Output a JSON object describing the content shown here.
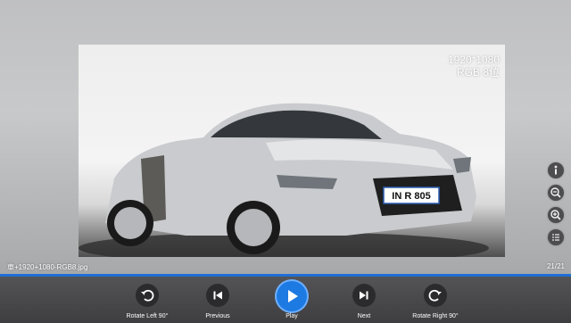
{
  "image_info": {
    "resolution": "1920*1080",
    "color_format": "RGB 8位",
    "filename": "車+1920+1080-RGB8.jpg",
    "counter": "21/21",
    "plate_text": "IN R 805"
  },
  "side_tools": [
    {
      "icon": "info-icon"
    },
    {
      "icon": "zoom-out-icon"
    },
    {
      "icon": "zoom-in-icon"
    },
    {
      "icon": "list-icon"
    }
  ],
  "controls": {
    "rotate_left_label": "Rotate Left 90°",
    "previous_label": "Previous",
    "play_label": "Play",
    "next_label": "Next",
    "rotate_right_label": "Rotate Right 90°"
  },
  "colors": {
    "accent": "#1e7ae3",
    "progress": "#1f6fd6",
    "control_bar": "#48484a"
  }
}
